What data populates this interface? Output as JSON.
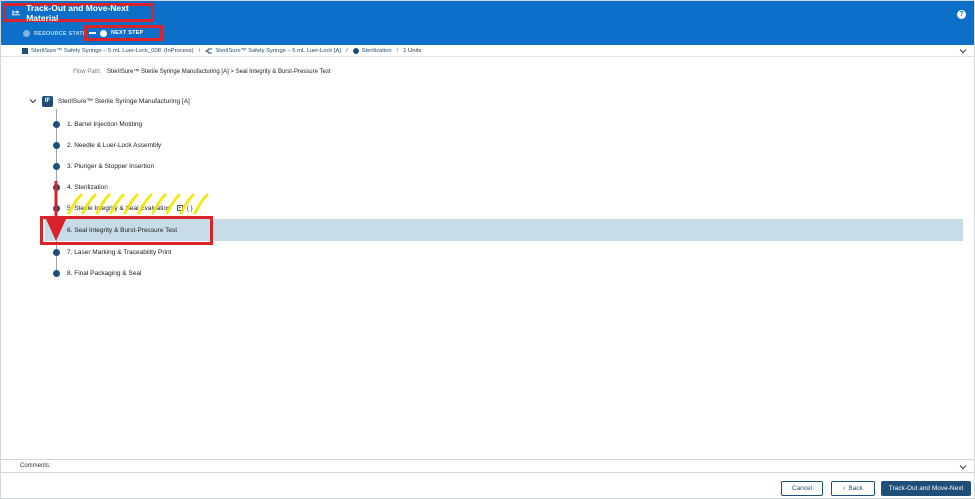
{
  "header": {
    "title": "Track-Out and Move-Next Material",
    "help": "?",
    "steps": [
      {
        "label": "RESOURCE STATE"
      },
      {
        "label": "NEXT STEP"
      }
    ]
  },
  "breadcrumb": {
    "material": "SterilSure™ Safety Syringe – 5 mL Luer-Lock_008",
    "state": "(InProcess)",
    "product": "SterilSure™ Safety Syringe – 5 mL Luer-Lock [A]",
    "step": "Sterilization",
    "units": "1 Units",
    "separator": "/"
  },
  "flow_path": {
    "label": "Flow Path:",
    "value": "SterilSure™ Sterile Syringe Manufacturing [A] > Seal Integrity & Burst-Pressure Test"
  },
  "tree": {
    "root_icon": "IF",
    "root_label": "SterilSure™ Sterile Syringe Manufacturing [A]",
    "steps": [
      {
        "label": "1. Barrel Injection Molding"
      },
      {
        "label": "2. Needle & Luer-Lock Assembly"
      },
      {
        "label": "3. Plunger & Stopper Insertion"
      },
      {
        "label": "4. Sterilization"
      },
      {
        "label": "5. Sterile Integrity & Seal Evaluation"
      },
      {
        "label": "6. Seal Integrity & Burst-Pressure Test"
      },
      {
        "label": "7. Laser Marking & Traceability Print"
      },
      {
        "label": "8. Final Packaging & Seal"
      }
    ],
    "step5_icons": [
      "+",
      "{ }"
    ],
    "selected_step": "6. Seal Integrity & Burst-Pressure Test"
  },
  "footer": {
    "comments_label": "Comments:",
    "cancel": "Cancel",
    "back": "Back",
    "back_icon": "‹",
    "primary": "Track-Out and Move-Next"
  },
  "colors": {
    "header_bg": "#0d6fc7",
    "annotation_red": "#d8232a",
    "annotation_yellow": "#f2e600",
    "selected_row": "#c8dce8",
    "primary_button": "#1f4e79"
  },
  "icons": {
    "title": "track-out-icon",
    "help": "help-icon",
    "chevron": "chevron-down-icon"
  }
}
